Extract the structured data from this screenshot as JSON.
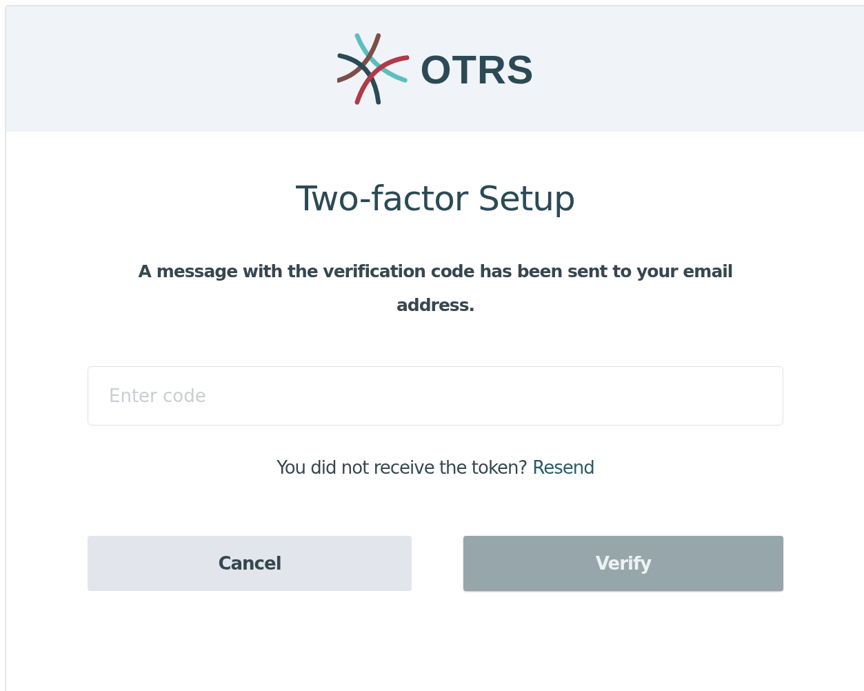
{
  "header": {
    "logo_text": "OTRS"
  },
  "title": "Two-factor Setup",
  "message": "A message with the verification code has been sent to your email address.",
  "code_field": {
    "placeholder": "Enter code"
  },
  "resend": {
    "question": "You did not receive the token?",
    "link": "Resend"
  },
  "buttons": [
    {
      "label": "Cancel",
      "kind": "secondary",
      "disabled": false
    },
    {
      "label": "Verify",
      "kind": "primary",
      "disabled": true
    }
  ]
}
